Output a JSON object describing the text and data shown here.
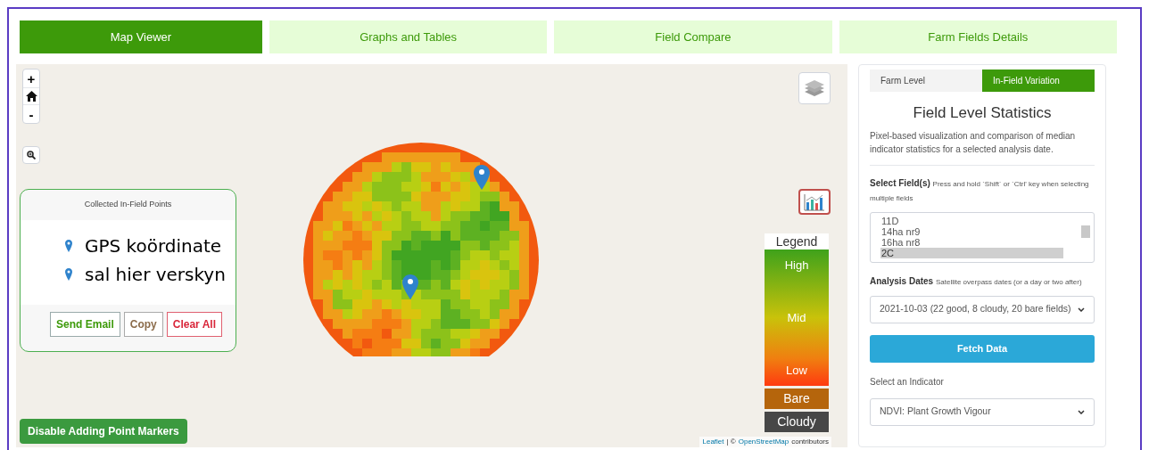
{
  "tabs": [
    {
      "label": "Map Viewer",
      "selected": true
    },
    {
      "label": "Graphs and Tables",
      "selected": false
    },
    {
      "label": "Field Compare",
      "selected": false
    },
    {
      "label": "Farm Fields Details",
      "selected": false
    }
  ],
  "map": {
    "zoom_controls": [
      "+",
      "-"
    ],
    "points_panel": {
      "title": "Collected In-Field Points",
      "message_lines": [
        "GPS koördinate",
        "sal hier verskyn"
      ],
      "buttons": [
        {
          "label": "Send Email",
          "kind": "success"
        },
        {
          "label": "Copy",
          "kind": "neutral"
        },
        {
          "label": "Clear All",
          "kind": "danger"
        }
      ]
    },
    "legend": {
      "title": "Legend",
      "gradient_labels": [
        "High",
        "Mid",
        "Low"
      ],
      "classes": [
        {
          "label": "Bare",
          "color": "#b5650c"
        },
        {
          "label": "Cloudy",
          "color": "#474747"
        }
      ]
    },
    "toggle_button": "Disable Adding Point Markers",
    "attribution": {
      "links": [
        "Leaflet",
        "OpenStreetMap"
      ],
      "separator": "| ©",
      "suffix": "contributors"
    }
  },
  "panel": {
    "tabs": [
      {
        "label": "Farm Level",
        "selected": false
      },
      {
        "label": "In-Field Variation",
        "selected": true
      }
    ],
    "title": "Field Level Statistics",
    "description": "Pixel-based visualization and comparison of median indicator statistics for a selected analysis date.",
    "fields": {
      "label": "Select Field(s)",
      "hint": "Press and hold `Shift` or `Ctrl' key when selecting multiple fields",
      "options": [
        {
          "label": "11D",
          "selected": false
        },
        {
          "label": "14ha nr9",
          "selected": false
        },
        {
          "label": "16ha nr8",
          "selected": false
        },
        {
          "label": "2C",
          "selected": true
        }
      ]
    },
    "dates": {
      "label": "Analysis Dates",
      "hint": "Satellite overpass dates (or a day or two after)",
      "value": "2021-10-03 (22 good, 8 cloudy, 20 bare fields)"
    },
    "fetch_button": "Fetch Data",
    "indicator": {
      "label": "Select an Indicator",
      "value": "NDVI: Plant Growth Vigour"
    }
  }
}
